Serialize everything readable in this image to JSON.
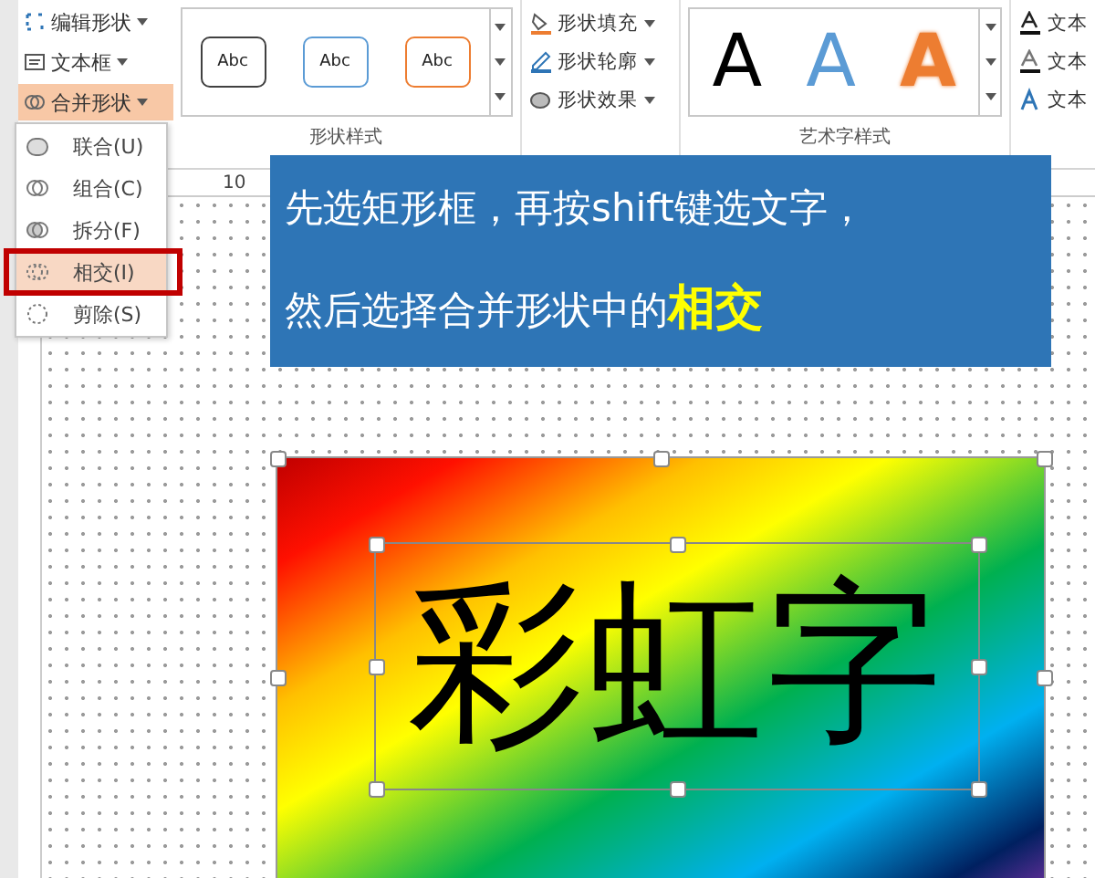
{
  "ribbon": {
    "left_buttons": [
      {
        "label": "编辑形状",
        "kind": "edit",
        "selected": false
      },
      {
        "label": "文本框",
        "kind": "textbox",
        "selected": false
      },
      {
        "label": "合并形状",
        "kind": "merge",
        "selected": true
      }
    ],
    "shape_styles": {
      "presets": [
        {
          "label": "Abc",
          "color": "#404040"
        },
        {
          "label": "Abc",
          "color": "#5b9bd5"
        },
        {
          "label": "Abc",
          "color": "#ed7d31"
        }
      ],
      "group_label": "形状样式"
    },
    "shape_commands": [
      {
        "label": "形状填充",
        "kind": "fill"
      },
      {
        "label": "形状轮廓",
        "kind": "outline"
      },
      {
        "label": "形状效果",
        "kind": "effect"
      }
    ],
    "wordart": {
      "presets": [
        {
          "label": "A",
          "kind": "solid",
          "color": "#000000"
        },
        {
          "label": "A",
          "kind": "solid",
          "color": "#5b9bd5"
        },
        {
          "label": "A",
          "kind": "outline",
          "color": "#ed7d31"
        }
      ],
      "group_label": "艺术字样式"
    },
    "text_commands": [
      {
        "label": "文本",
        "kind": "fill"
      },
      {
        "label": "文本",
        "kind": "outline"
      },
      {
        "label": "文本",
        "kind": "effect"
      }
    ]
  },
  "ruler": {
    "label": "10"
  },
  "merge_menu": {
    "items": [
      {
        "label": "联合(U)",
        "kind": "union",
        "selected": false
      },
      {
        "label": "组合(C)",
        "kind": "combine",
        "selected": false
      },
      {
        "label": "拆分(F)",
        "kind": "fragment",
        "selected": false
      },
      {
        "label": "相交(I)",
        "kind": "intersect",
        "selected": true
      },
      {
        "label": "剪除(S)",
        "kind": "subtract",
        "selected": false
      }
    ]
  },
  "callout": {
    "line_1": "先选矩形框，再按shift键选文字，",
    "line_2": "然后选择合并形状中的**相交**"
  },
  "slide": {
    "text": "彩虹字"
  }
}
